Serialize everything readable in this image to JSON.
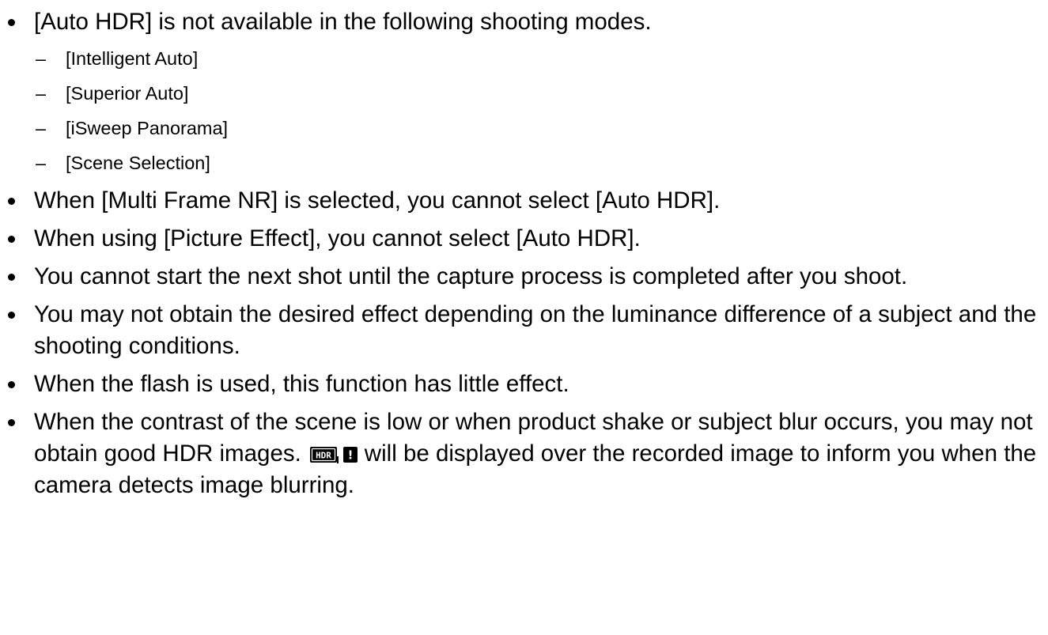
{
  "bullets": [
    {
      "text": "[Auto HDR] is not available in the following shooting modes.",
      "sub_items": [
        "[Intelligent Auto]",
        "[Superior Auto]",
        "[iSweep Panorama]",
        "[Scene Selection]"
      ]
    },
    {
      "text": "When [Multi Frame NR] is selected, you cannot select [Auto HDR]."
    },
    {
      "text": "When using [Picture Effect], you cannot select [Auto HDR]."
    },
    {
      "text": "You cannot start the next shot until the capture process is completed after you shoot."
    },
    {
      "text": "You may not obtain the desired effect depending on the luminance difference of a subject and the shooting conditions."
    },
    {
      "text": "When the flash is used, this function has little effect."
    },
    {
      "text_before_icon": "When the contrast of the scene is low or when product shake or subject blur occurs, you may not obtain good HDR images.",
      "icon": "hdr-warning-icon",
      "icon_label": "HDR",
      "icon_mark": "!",
      "text_after_icon": "will be displayed over the recorded image to inform you when the camera detects image blurring."
    }
  ],
  "sub_item_marker": "–"
}
